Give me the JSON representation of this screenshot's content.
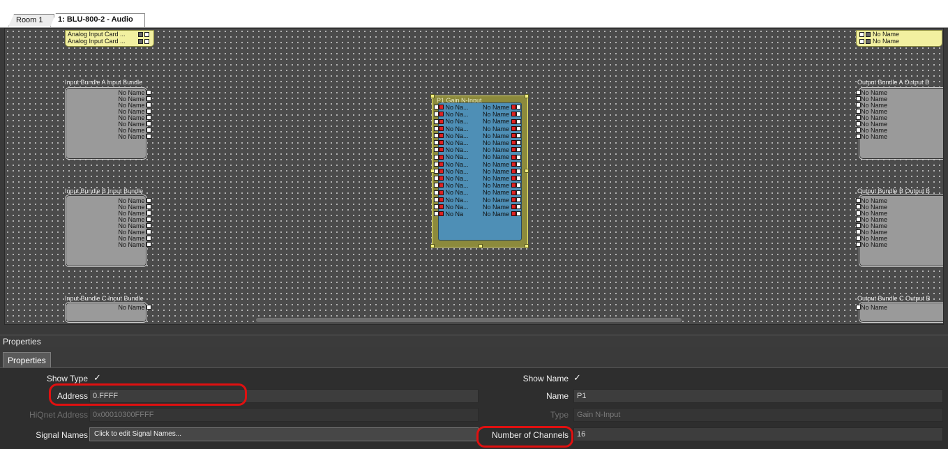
{
  "tabs": [
    "Room 1",
    "1: BLU-800-2 - Audio"
  ],
  "top_left_card": [
    "Analog Input Card ...",
    "Analog Input Card ..."
  ],
  "top_right_card": [
    "No Name",
    "No Name"
  ],
  "bundles_in": [
    {
      "label": "Input Bundle A  Input Bundle",
      "rows": [
        "No Name",
        "No Name",
        "No Name",
        "No Name",
        "No Name",
        "No Name",
        "No Name",
        "No Name"
      ]
    },
    {
      "label": "Input Bundle B  Input Bundle",
      "rows": [
        "No Name",
        "No Name",
        "No Name",
        "No Name",
        "No Name",
        "No Name",
        "No Name",
        "No Name"
      ]
    },
    {
      "label": "Input Bundle C  Input Bundle",
      "rows": [
        "No Name"
      ]
    }
  ],
  "bundles_out": [
    {
      "label": "Output Bundle A  Output B",
      "rows": [
        "No Name",
        "No Name",
        "No Name",
        "No Name",
        "No Name",
        "No Name",
        "No Name",
        "No Name"
      ]
    },
    {
      "label": "Output Bundle B  Output B",
      "rows": [
        "No Name",
        "No Name",
        "No Name",
        "No Name",
        "No Name",
        "No Name",
        "No Name",
        "No Name"
      ]
    },
    {
      "label": "Output Bundle C  Output B",
      "rows": [
        "No Name"
      ]
    }
  ],
  "gain_block": {
    "title": "P1  Gain N-Input",
    "in_label": "No Na...",
    "out_label": "No Name",
    "last_in_label": "No Na",
    "channels": 16
  },
  "properties": {
    "panel_title": "Properties",
    "tab_label": "Properties",
    "show_type_label": "Show Type",
    "show_type_check": "✓",
    "show_name_label": "Show Name",
    "show_name_check": "✓",
    "address_label": "Address",
    "address_value": "0.FFFF",
    "name_label": "Name",
    "name_value": "P1",
    "hiqnet_label": "HiQnet Address",
    "hiqnet_value": "0x00010300FFFF",
    "type_label": "Type",
    "type_value": "Gain N-Input",
    "signal_names_label": "Signal Names",
    "signal_names_button": "Click to edit Signal Names...",
    "channels_label": "Number of Channels",
    "channels_value": "16"
  },
  "colors": {
    "highlight_ring": "#e01010",
    "gain_body": "#4e8fb6",
    "gain_frame": "#8c8a3c"
  }
}
